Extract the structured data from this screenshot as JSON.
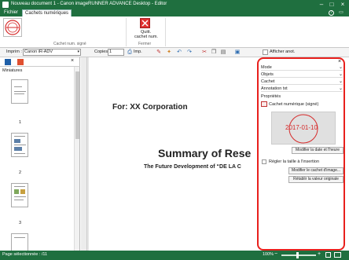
{
  "window": {
    "title": "Nouveau document 1 - Canon imageRUNNER ADVANCE Desktop - Editor"
  },
  "ribbon_tabs": [
    {
      "label": "Fichier"
    },
    {
      "label": "Cachets numériques"
    }
  ],
  "ribbon": {
    "stamp_group_label": "Cachet num. signé",
    "stamp_button_label": "Cachet num. signé",
    "quit_button_label_line1": "Quitt.",
    "quit_button_label_line2": "cachet num.",
    "close_group_label": "Fermer"
  },
  "toolbar": {
    "printer_label": "Imprim :",
    "printer_value": "Canon iR-ADV",
    "copies_label": "Copies:",
    "copies_value": "1",
    "print_button_label": "Imp.",
    "afficher_label": "Afficher anot."
  },
  "left_panel": {
    "label": "Miniatures",
    "thumbnails": [
      {
        "page": "1"
      },
      {
        "page": "2"
      },
      {
        "page": "3"
      }
    ]
  },
  "document": {
    "for_line": "For: XX Corporation",
    "title": "Summary of Rese",
    "subtitle": "The Future Development of “DE LA C"
  },
  "right_panel": {
    "sections": [
      {
        "label": "Mode"
      },
      {
        "label": "Objets"
      },
      {
        "label": "Cachet"
      },
      {
        "label": "Annotation txt"
      }
    ],
    "properties_label": "Propriétés",
    "stamp_item_label": "Cachet numérique (signé)",
    "stamp_date": "2017-01-10",
    "modify_date_button": "Modifier la date et l'heure",
    "resize_checkbox_label": "Régler la taille à l'insertion",
    "modify_image_button": "Modifier le cachet d'image...",
    "restore_button": "Rétablir la valeur originale"
  },
  "status_bar": {
    "page_text": "Page sélectionnée : /11",
    "zoom": "100%"
  },
  "colors": {
    "brand_green": "#1f6f3f",
    "highlight_red": "#e8201c",
    "stamp_red": "#d62a2a"
  }
}
